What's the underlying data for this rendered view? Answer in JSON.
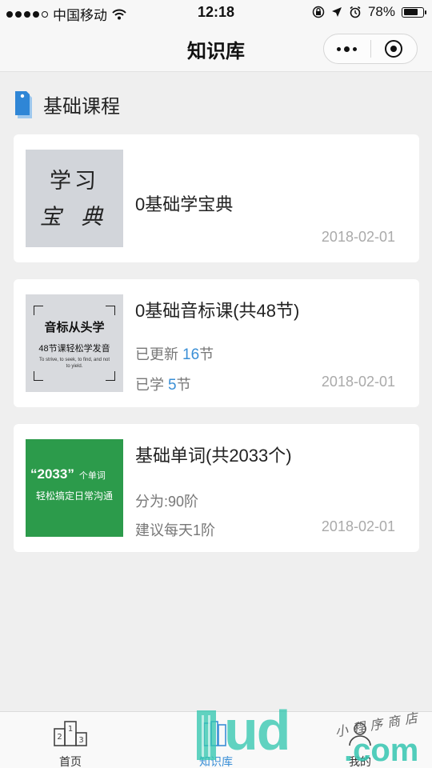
{
  "status_bar": {
    "carrier": "中国移动",
    "time": "12:18",
    "battery": "78%",
    "battery_level": 0.78
  },
  "nav": {
    "title": "知识库"
  },
  "section": {
    "title": "基础课程"
  },
  "courses": [
    {
      "thumb_line1": "学习",
      "thumb_line2": "宝 典",
      "title": "0基础学宝典",
      "date": "2018-02-01"
    },
    {
      "thumb_line1": "音标从头学",
      "thumb_line2": "48节课轻松学发音",
      "thumb_line3": "To strive, to seek, to find, and not to yield.",
      "title": "0基础音标课(共48节)",
      "updated_label": "已更新",
      "updated_count": "16",
      "updated_unit": "节",
      "learned_label": "已学",
      "learned_count": "5",
      "learned_unit": "节",
      "date": "2018-02-01"
    },
    {
      "thumb_line1": "“2033”",
      "thumb_line1_small": "个单词",
      "thumb_line2": "轻松搞定日常沟通",
      "title": "基础单词(共2033个)",
      "meta1": "分为:90阶",
      "meta2": "建议每天1阶",
      "date": "2018-02-01"
    }
  ],
  "tabs": [
    {
      "label": "首页"
    },
    {
      "label": "知识库"
    },
    {
      "label": "我的"
    }
  ],
  "watermark": {
    "main": "ud",
    "suffix": ".com",
    "script": "小程序商店"
  },
  "colors": {
    "accent": "#3a8fd6",
    "green_thumb": "#2c9b4b",
    "watermark": "#34c6b0"
  }
}
